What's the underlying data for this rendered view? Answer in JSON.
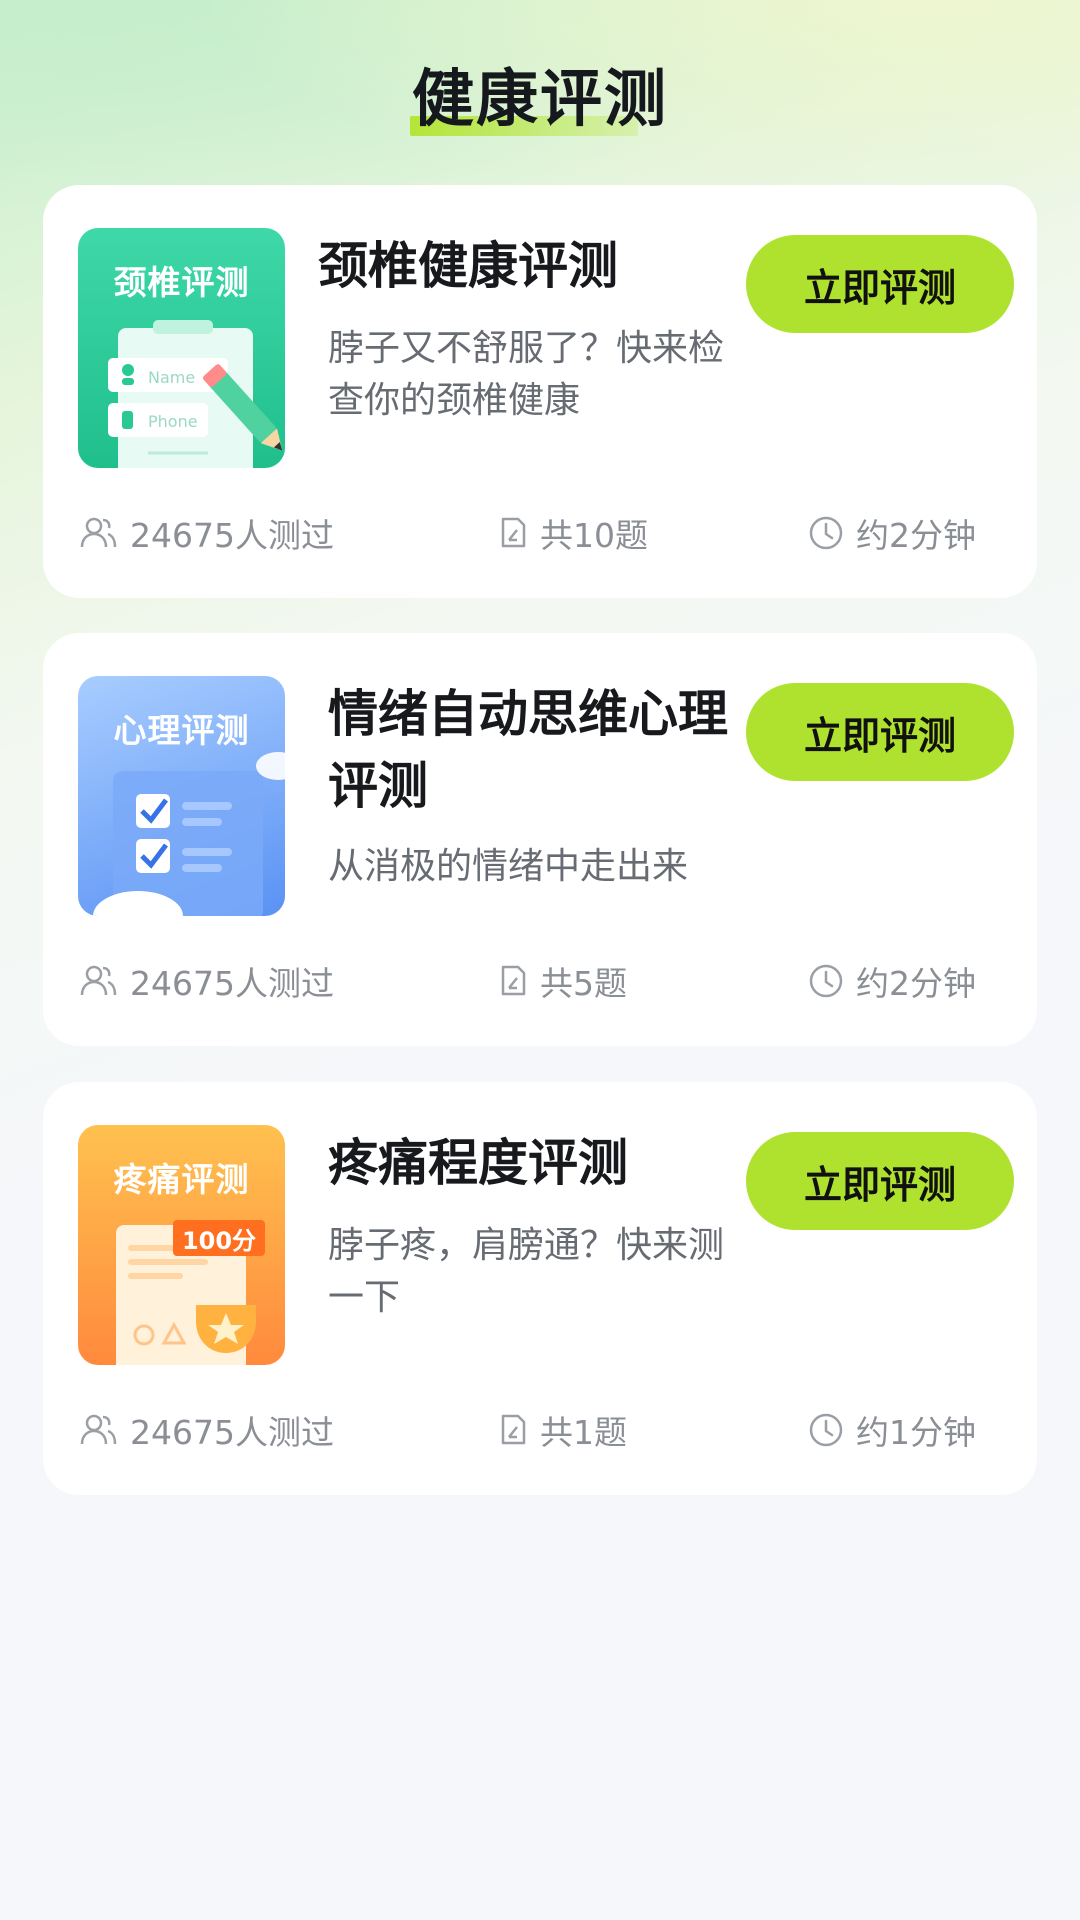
{
  "header": {
    "title": "健康评测"
  },
  "cards": [
    {
      "thumb_label": "颈椎评测",
      "thumb_fields": [
        "Name",
        "Phone"
      ],
      "title": "颈椎健康评测",
      "description": "脖子又不舒服了？快来检查你的颈椎健康",
      "button_label": "立即评测",
      "participants": "24675人测过",
      "questions": "共10题",
      "duration": "约2分钟",
      "thumb_colors": [
        "#3fd8a8",
        "#1fbf8c"
      ]
    },
    {
      "thumb_label": "心理评测",
      "title": "情绪自动思维心理评测",
      "description": "从消极的情绪中走出来",
      "button_label": "立即评测",
      "participants": "24675人测过",
      "questions": "共5题",
      "duration": "约2分钟",
      "thumb_colors": [
        "#a4cbff",
        "#5b93f5"
      ]
    },
    {
      "thumb_label": "疼痛评测",
      "thumb_badge": "100分",
      "title": "疼痛程度评测",
      "description": "脖子疼，肩膀通？快来测一下",
      "button_label": "立即评测",
      "participants": "24675人测过",
      "questions": "共1题",
      "duration": "约1分钟",
      "thumb_colors": [
        "#ffc04d",
        "#ff8a3d"
      ]
    }
  ],
  "icons": {
    "people": "people-icon",
    "questions": "document-icon",
    "time": "clock-icon"
  },
  "colors": {
    "accent": "#afe22e",
    "title_text": "#17191d",
    "meta_text": "#8a8e95"
  }
}
